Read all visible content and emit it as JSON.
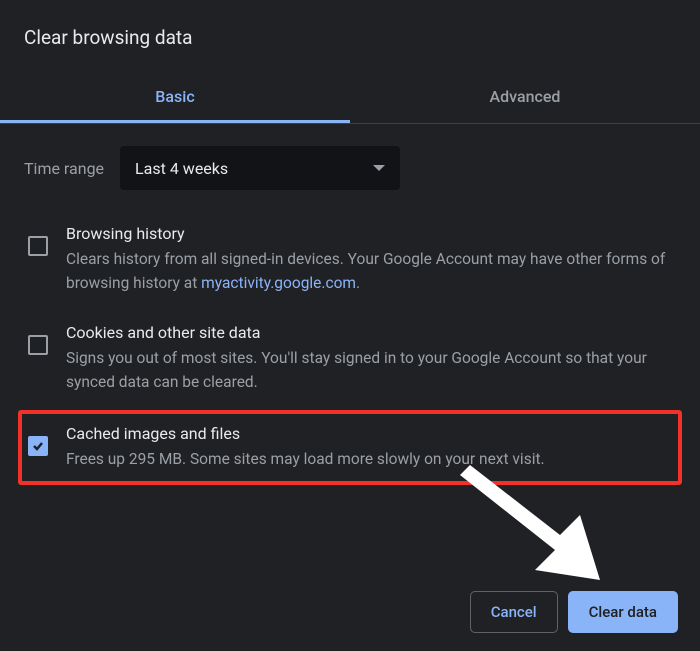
{
  "dialog": {
    "title": "Clear browsing data"
  },
  "tabs": {
    "basic": "Basic",
    "advanced": "Advanced"
  },
  "time": {
    "label": "Time range",
    "value": "Last 4 weeks"
  },
  "items": {
    "history": {
      "title": "Browsing history",
      "desc_a": "Clears history from all signed-in devices. Your Google Account may have other forms of browsing history at ",
      "link": "myaccount.google.com",
      "link_text": "myactivity.google.com",
      "desc_b": "."
    },
    "cookies": {
      "title": "Cookies and other site data",
      "desc": "Signs you out of most sites. You'll stay signed in to your Google Account so that your synced data can be cleared."
    },
    "cache": {
      "title": "Cached images and files",
      "desc": "Frees up 295 MB. Some sites may load more slowly on your next visit."
    }
  },
  "buttons": {
    "cancel": "Cancel",
    "clear": "Clear data"
  },
  "colors": {
    "accent": "#8ab4f8",
    "highlight": "#f1312a"
  }
}
